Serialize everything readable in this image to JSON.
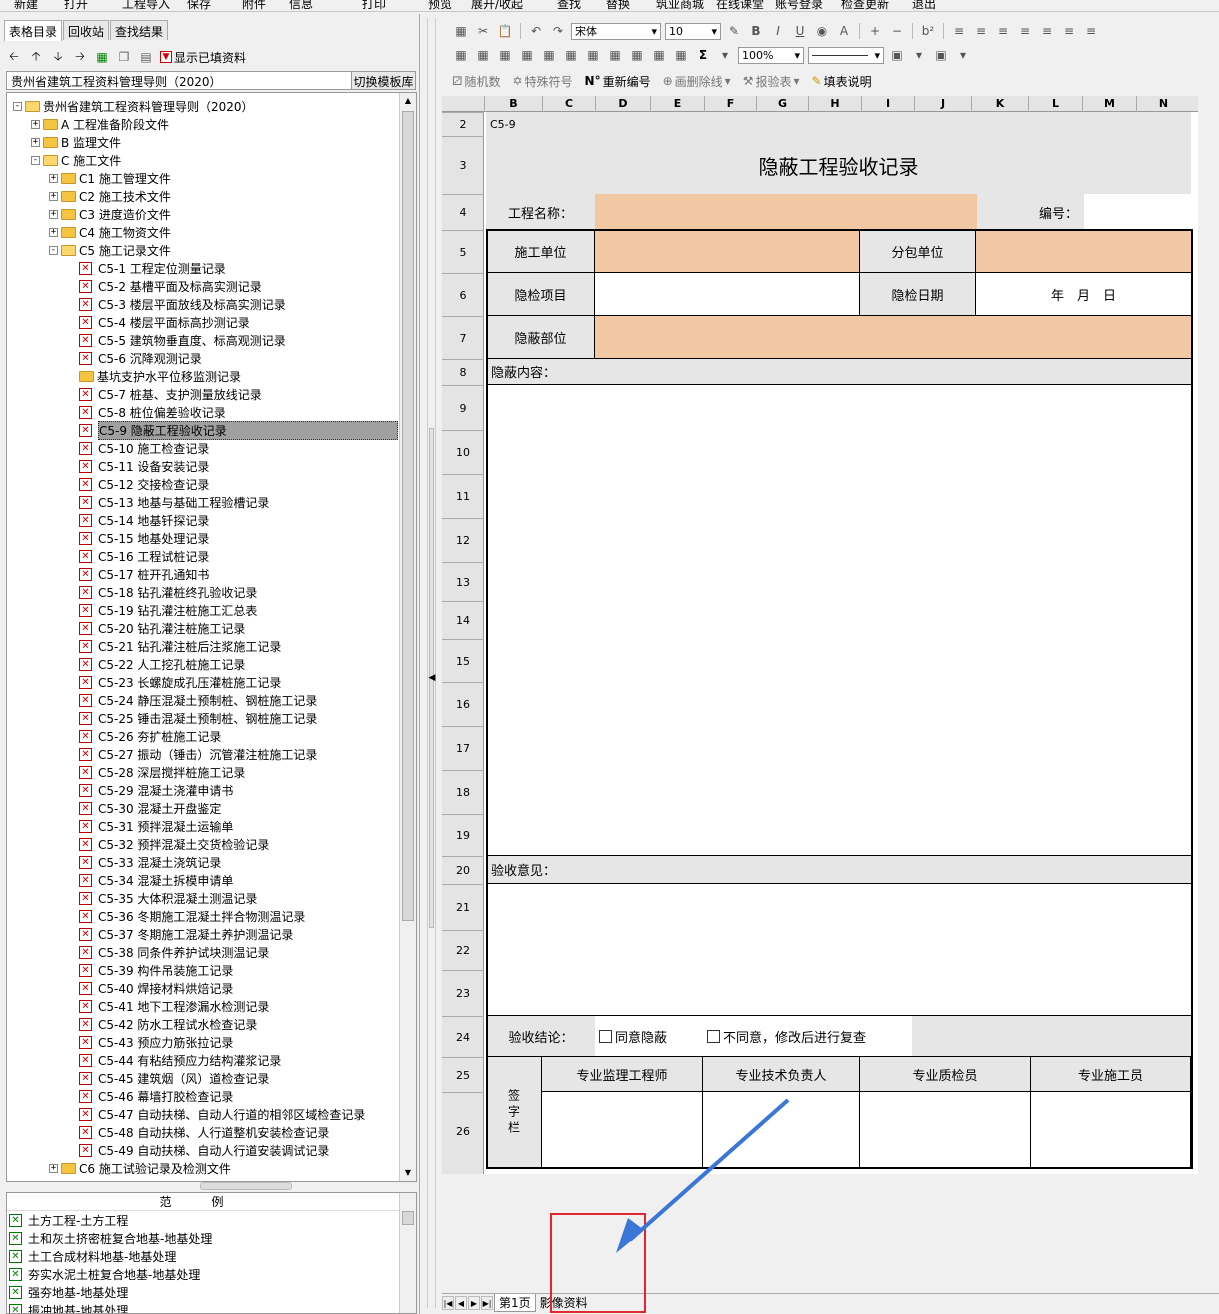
{
  "menubar": [
    "新建",
    "打开",
    "工程导入",
    "保存",
    "附件",
    "信息",
    "打印",
    "预览",
    "展开/收起",
    "查找",
    "替换",
    "筑业商城",
    "在线课堂",
    "账号登录",
    "检查更新",
    "退出"
  ],
  "left_tabs": [
    "表格目录",
    "回收站",
    "查找结果"
  ],
  "left_toolbar": {
    "show_filled": "显示已填资料"
  },
  "template": {
    "name": "贵州省建筑工程资料管理导则（2020）",
    "switch_label": "切换模板库"
  },
  "tree": [
    {
      "level": 0,
      "type": "folder-open",
      "exp": "-",
      "label": "贵州省建筑工程资料管理导则（2020）"
    },
    {
      "level": 1,
      "type": "folder",
      "exp": "+",
      "label": "A 工程准备阶段文件"
    },
    {
      "level": 1,
      "type": "folder",
      "exp": "+",
      "label": "B 监理文件"
    },
    {
      "level": 1,
      "type": "folder-open",
      "exp": "-",
      "label": "C 施工文件"
    },
    {
      "level": 2,
      "type": "folder",
      "exp": "+",
      "label": "C1 施工管理文件"
    },
    {
      "level": 2,
      "type": "folder",
      "exp": "+",
      "label": "C2 施工技术文件"
    },
    {
      "level": 2,
      "type": "folder",
      "exp": "+",
      "label": "C3 进度造价文件"
    },
    {
      "level": 2,
      "type": "folder",
      "exp": "+",
      "label": "C4 施工物资文件"
    },
    {
      "level": 2,
      "type": "folder-open",
      "exp": "-",
      "label": "C5 施工记录文件"
    },
    {
      "level": 3,
      "type": "x",
      "label": "C5-1 工程定位测量记录"
    },
    {
      "level": 3,
      "type": "x",
      "label": "C5-2 基槽平面及标高实测记录"
    },
    {
      "level": 3,
      "type": "x",
      "label": "C5-3 楼层平面放线及标高实测记录"
    },
    {
      "level": 3,
      "type": "x",
      "label": "C5-4 楼层平面标高抄测记录"
    },
    {
      "level": 3,
      "type": "x",
      "label": "C5-5 建筑物垂直度、标高观测记录"
    },
    {
      "level": 3,
      "type": "x",
      "label": "C5-6 沉降观测记录"
    },
    {
      "level": 3,
      "type": "folder",
      "label": "基坑支护水平位移监测记录"
    },
    {
      "level": 3,
      "type": "x",
      "label": "C5-7 桩基、支护测量放线记录"
    },
    {
      "level": 3,
      "type": "x",
      "label": "C5-8 桩位偏差验收记录"
    },
    {
      "level": 3,
      "type": "x",
      "label": "C5-9 隐蔽工程验收记录",
      "selected": true
    },
    {
      "level": 3,
      "type": "x",
      "label": "C5-10 施工检查记录"
    },
    {
      "level": 3,
      "type": "x",
      "label": "C5-11 设备安装记录"
    },
    {
      "level": 3,
      "type": "x",
      "label": "C5-12 交接检查记录"
    },
    {
      "level": 3,
      "type": "x",
      "label": "C5-13 地基与基础工程验槽记录"
    },
    {
      "level": 3,
      "type": "x",
      "label": "C5-14 地基钎探记录"
    },
    {
      "level": 3,
      "type": "x",
      "label": "C5-15 地基处理记录"
    },
    {
      "level": 3,
      "type": "x",
      "label": "C5-16 工程试桩记录"
    },
    {
      "level": 3,
      "type": "x",
      "label": "C5-17 桩开孔通知书"
    },
    {
      "level": 3,
      "type": "x",
      "label": "C5-18 钻孔灌桩终孔验收记录"
    },
    {
      "level": 3,
      "type": "x",
      "label": "C5-19 钻孔灌注桩施工汇总表"
    },
    {
      "level": 3,
      "type": "x",
      "label": "C5-20 钻孔灌注桩施工记录"
    },
    {
      "level": 3,
      "type": "x",
      "label": "C5-21 钻孔灌注桩后注浆施工记录"
    },
    {
      "level": 3,
      "type": "x",
      "label": "C5-22 人工挖孔桩施工记录"
    },
    {
      "level": 3,
      "type": "x",
      "label": "C5-23 长螺旋成孔压灌桩施工记录"
    },
    {
      "level": 3,
      "type": "x",
      "label": "C5-24 静压混凝土预制桩、钢桩施工记录"
    },
    {
      "level": 3,
      "type": "x",
      "label": "C5-25 锤击混凝土预制桩、钢桩施工记录"
    },
    {
      "level": 3,
      "type": "x",
      "label": "C5-26 夯扩桩施工记录"
    },
    {
      "level": 3,
      "type": "x",
      "label": "C5-27 振动（锤击）沉管灌注桩施工记录"
    },
    {
      "level": 3,
      "type": "x",
      "label": "C5-28 深层搅拌桩施工记录"
    },
    {
      "level": 3,
      "type": "x",
      "label": "C5-29 混凝土浇灌申请书"
    },
    {
      "level": 3,
      "type": "x",
      "label": "C5-30 混凝土开盘鉴定"
    },
    {
      "level": 3,
      "type": "x",
      "label": "C5-31 预拌混凝土运输单"
    },
    {
      "level": 3,
      "type": "x",
      "label": "C5-32 预拌混凝土交货检验记录"
    },
    {
      "level": 3,
      "type": "x",
      "label": "C5-33 混凝土浇筑记录"
    },
    {
      "level": 3,
      "type": "x",
      "label": "C5-34 混凝土拆模申请单"
    },
    {
      "level": 3,
      "type": "x",
      "label": "C5-35 大体积混凝土测温记录"
    },
    {
      "level": 3,
      "type": "x",
      "label": "C5-36 冬期施工混凝土拌合物测温记录"
    },
    {
      "level": 3,
      "type": "x",
      "label": "C5-37 冬期施工混凝土养护测温记录"
    },
    {
      "level": 3,
      "type": "x",
      "label": "C5-38 同条件养护试块测温记录"
    },
    {
      "level": 3,
      "type": "x",
      "label": "C5-39 构件吊装施工记录"
    },
    {
      "level": 3,
      "type": "x",
      "label": "C5-40 焊接材料烘焙记录"
    },
    {
      "level": 3,
      "type": "x",
      "label": "C5-41 地下工程渗漏水检测记录"
    },
    {
      "level": 3,
      "type": "x",
      "label": "C5-42 防水工程试水检查记录"
    },
    {
      "level": 3,
      "type": "x",
      "label": "C5-43 预应力筋张拉记录"
    },
    {
      "level": 3,
      "type": "x",
      "label": "C5-44 有粘结预应力结构灌浆记录"
    },
    {
      "level": 3,
      "type": "x",
      "label": "C5-45 建筑烟（风）道检查记录"
    },
    {
      "level": 3,
      "type": "x",
      "label": "C5-46 幕墙打胶检查记录"
    },
    {
      "level": 3,
      "type": "x",
      "label": "C5-47 自动扶梯、自动人行道的相邻区域检查记录"
    },
    {
      "level": 3,
      "type": "x",
      "label": "C5-48 自动扶梯、人行道整机安装检查记录"
    },
    {
      "level": 3,
      "type": "x",
      "label": "C5-49 自动扶梯、自动人行道安装调试记录"
    },
    {
      "level": 2,
      "type": "folder",
      "exp": "+",
      "label": "C6 施工试验记录及检测文件"
    }
  ],
  "examples": {
    "header": "范例",
    "items": [
      "土方工程-土方工程",
      "土和灰土挤密桩复合地基-地基处理",
      "土工合成材料地基-地基处理",
      "夯实水泥土桩复合地基-地基处理",
      "强夯地基-地基处理",
      "振冲地基-地基处理"
    ]
  },
  "toolbar": {
    "font_name": "宋体",
    "font_size": "10",
    "zoom": "100%",
    "sigma": "Σ",
    "tools3": [
      "随机数",
      "特殊符号",
      "重新编号",
      "画删除线",
      "报验表",
      "填表说明"
    ]
  },
  "columns": [
    "B",
    "C",
    "D",
    "E",
    "F",
    "G",
    "H",
    "I",
    "J",
    "K",
    "L",
    "M",
    "N"
  ],
  "rows": [
    "2",
    "3",
    "4",
    "5",
    "6",
    "7",
    "8",
    "9",
    "10",
    "11",
    "12",
    "13",
    "14",
    "15",
    "16",
    "17",
    "18",
    "19",
    "20",
    "21",
    "22",
    "23",
    "24",
    "25",
    "26"
  ],
  "form": {
    "code": "C5-9",
    "title": "隐蔽工程验收记录",
    "project_name_label": "工程名称：",
    "number_label": "编号：",
    "construction_unit_label": "施工单位",
    "subcontract_unit_label": "分包单位",
    "inspection_item_label": "隐检项目",
    "inspection_date_label": "隐检日期",
    "date_placeholder": "年　月　日",
    "hidden_part_label": "隐蔽部位",
    "hidden_content_label": "隐蔽内容：",
    "acceptance_opinion_label": "验收意见：",
    "conclusion_label": "验收结论：",
    "agree_label": "同意隐蔽",
    "disagree_label": "不同意，修改后进行复查",
    "sign_label": "签字栏",
    "signers": [
      "专业监理工程师",
      "专业技术负责人",
      "专业质检员",
      "专业施工员"
    ]
  },
  "sheet_tabs": [
    "第1页",
    "影像资料"
  ],
  "colors": {
    "peach": "#f2c8a4",
    "grey": "#e6e6e6",
    "annotation_red": "#e3262f",
    "arrow_blue": "#3a76d8"
  }
}
